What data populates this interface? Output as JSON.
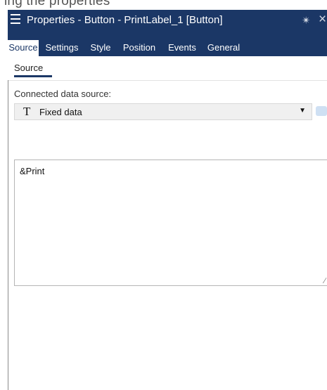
{
  "cropped_caption": "ing the properties",
  "panel": {
    "title": "Properties - Button - PrintLabel_1 [Button]"
  },
  "tabs": [
    {
      "label": "Source",
      "active": true
    },
    {
      "label": "Settings",
      "active": false
    },
    {
      "label": "Style",
      "active": false
    },
    {
      "label": "Position",
      "active": false
    },
    {
      "label": "Events",
      "active": false
    },
    {
      "label": "General",
      "active": false
    }
  ],
  "subtab": {
    "label": "Source"
  },
  "source": {
    "connected_label": "Connected data source:",
    "selected_value": "Fixed data",
    "selected_icon": "T",
    "text_value": "&Print"
  },
  "colors": {
    "header": "#1b3766",
    "accent": "#1b3766"
  }
}
